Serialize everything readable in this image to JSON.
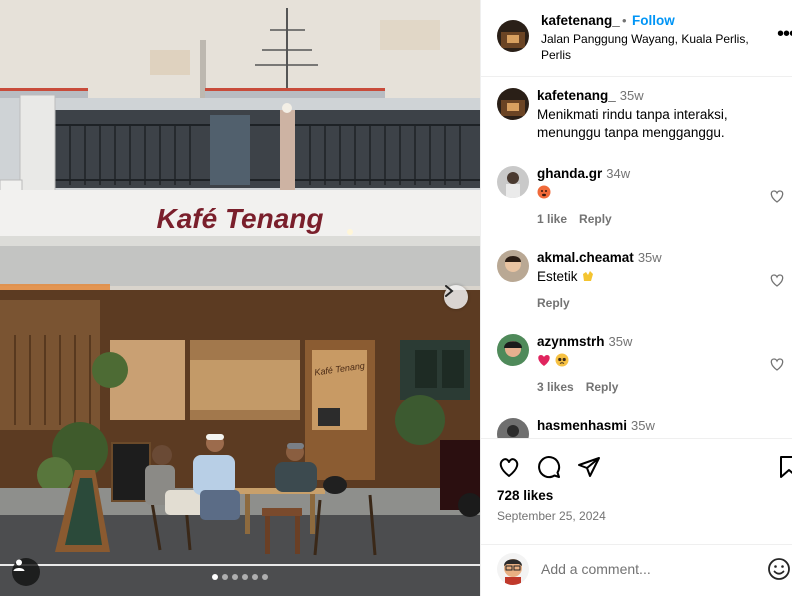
{
  "photo": {
    "sign_text": "Kafé Tenang",
    "door_text": "Kafé Tenang",
    "slides_total": 6,
    "slide_index": 1,
    "icons": {
      "next": "chevron-right-icon",
      "tag": "person-tag-icon"
    }
  },
  "header": {
    "username": "kafetenang_",
    "separator": "•",
    "follow_label": "Follow",
    "location": "Jalan Panggung Wayang, Kuala Perlis, Perlis",
    "more_label": "•••"
  },
  "caption": {
    "username": "kafetenang_",
    "time": "35w",
    "text": "Menikmati rindu tanpa interaksi, menunggu tanpa mengganggu."
  },
  "comments": [
    {
      "username": "ghanda.gr",
      "time": "34w",
      "text": "",
      "emoji": [
        "hot-face"
      ],
      "likes": "1 like",
      "reply": "Reply"
    },
    {
      "username": "akmal.cheamat",
      "time": "35w",
      "text": "Estetik",
      "emoji": [
        "clapping-hands"
      ],
      "likes": "",
      "reply": "Reply"
    },
    {
      "username": "azynmstrh",
      "time": "35w",
      "text": "",
      "emoji": [
        "red-heart",
        "pleading-face"
      ],
      "likes": "3 likes",
      "reply": "Reply"
    },
    {
      "username": "hasmenhasmi",
      "time": "35w"
    }
  ],
  "actions": {
    "likes": "728 likes",
    "date": "September 25, 2024",
    "icons": [
      "heart-icon",
      "comment-icon",
      "share-icon",
      "bookmark-icon"
    ]
  },
  "add_comment": {
    "placeholder": "Add a comment...",
    "emoji_icon": "smiley-icon"
  },
  "colors": {
    "link_blue": "#0095f6",
    "muted": "#737373",
    "sign_red": "#7a1f2b",
    "divider": "#efefef"
  }
}
